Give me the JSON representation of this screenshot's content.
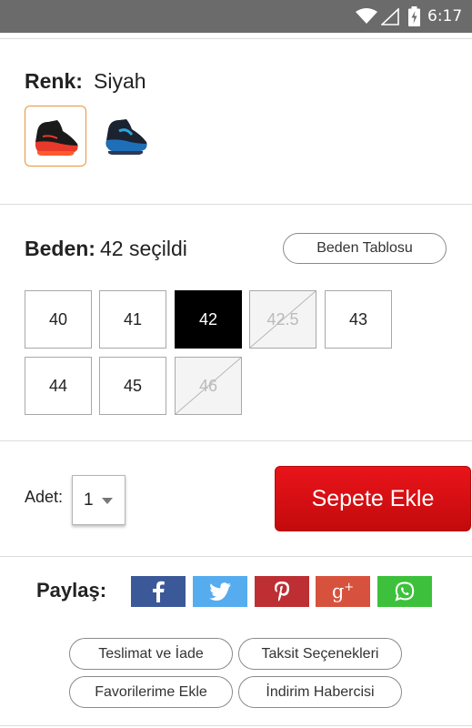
{
  "status_bar": {
    "time": "6:17"
  },
  "color": {
    "label": "Renk:",
    "value": "Siyah",
    "swatches": [
      {
        "name": "red-black shoe",
        "selected": true
      },
      {
        "name": "blue-black shoe",
        "selected": false
      }
    ]
  },
  "size": {
    "label": "Beden:",
    "value": "42 seçildi",
    "chart_button": "Beden Tablosu",
    "options": [
      {
        "label": "40",
        "state": "available"
      },
      {
        "label": "41",
        "state": "available"
      },
      {
        "label": "42",
        "state": "selected"
      },
      {
        "label": "42.5",
        "state": "unavailable"
      },
      {
        "label": "43",
        "state": "available"
      },
      {
        "label": "44",
        "state": "available"
      },
      {
        "label": "45",
        "state": "available"
      },
      {
        "label": "46",
        "state": "unavailable"
      }
    ]
  },
  "quantity": {
    "label": "Adet:",
    "value": "1"
  },
  "cart": {
    "button": "Sepete Ekle"
  },
  "share": {
    "label": "Paylaş:",
    "networks": [
      {
        "name": "facebook",
        "color": "#3b5998"
      },
      {
        "name": "twitter",
        "color": "#55acee"
      },
      {
        "name": "pinterest",
        "color": "#bd2f33"
      },
      {
        "name": "google-plus",
        "color": "#d6523d"
      },
      {
        "name": "whatsapp",
        "color": "#3dc13c"
      }
    ]
  },
  "links": {
    "delivery": "Teslimat ve İade",
    "installments": "Taksit Seçenekleri",
    "favorites": "Favorilerime Ekle",
    "price_alert": "İndirim Habercisi"
  }
}
